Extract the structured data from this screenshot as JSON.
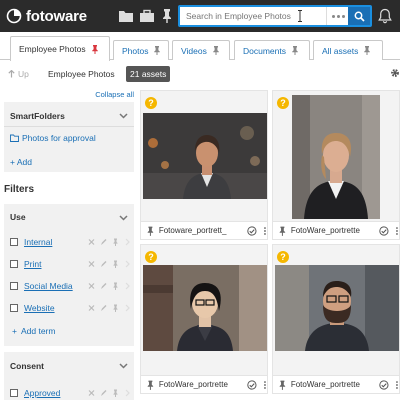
{
  "app": {
    "brand": "fotoware"
  },
  "search": {
    "placeholder": "Search in Employee Photos"
  },
  "tabs": [
    {
      "label": "Employee Photos",
      "active": true
    },
    {
      "label": "Photos",
      "active": false
    },
    {
      "label": "Videos",
      "active": false
    },
    {
      "label": "Documents",
      "active": false
    },
    {
      "label": "All assets",
      "active": false
    }
  ],
  "toolbar": {
    "up_label": "Up",
    "breadcrumb": "Employee Photos",
    "asset_count": "21 assets"
  },
  "sidebar": {
    "collapse_all": "Collapse all",
    "smartfolders": {
      "title": "SmartFolders",
      "folder": "Photos for approval",
      "add_label": "+ Add"
    },
    "filters_title": "Filters",
    "use": {
      "title": "Use",
      "items": [
        "Internal",
        "Print",
        "Social Media",
        "Website"
      ],
      "add_term": "Add term"
    },
    "consent": {
      "title": "Consent",
      "items": [
        "Approved"
      ]
    }
  },
  "assets": [
    {
      "name": "Fotoware_portrett_",
      "star": "?"
    },
    {
      "name": "FotoWare_portrette",
      "star": "?"
    },
    {
      "name": "FotoWare_portrette",
      "star": "?"
    },
    {
      "name": "FotoWare_portrette",
      "star": "?"
    }
  ],
  "colors": {
    "accent": "#1a6fb5",
    "topbar": "#2b2b2b",
    "star": "#f5b700"
  }
}
